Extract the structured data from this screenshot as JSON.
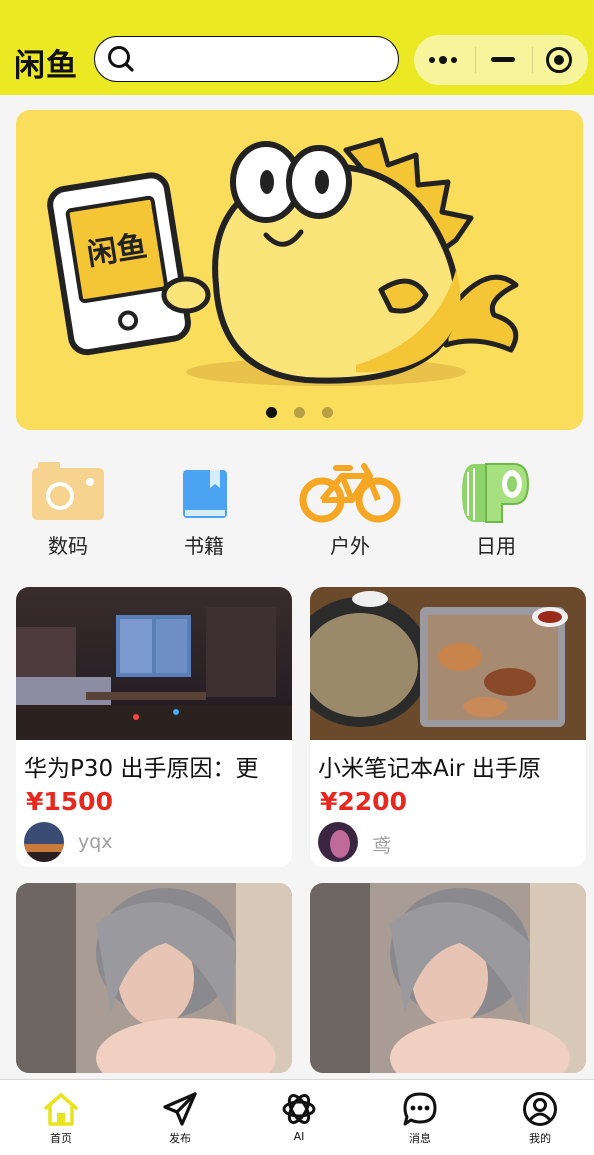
{
  "header": {
    "logo": "闲鱼",
    "search_placeholder": "",
    "accent_color": "#ebe824"
  },
  "banner": {
    "phone_text": "闲鱼",
    "slide_count": 3,
    "active_slide": 1
  },
  "categories": [
    {
      "label": "数码",
      "icon": "camera-icon",
      "color": "#f6d490"
    },
    {
      "label": "书籍",
      "icon": "book-icon",
      "color": "#4da3f3"
    },
    {
      "label": "户外",
      "icon": "bicycle-icon",
      "color": "#f5a623"
    },
    {
      "label": "日用",
      "icon": "tissue-roll-icon",
      "color": "#8fd36b"
    }
  ],
  "products": [
    {
      "title": "华为P30 出手原因：更",
      "price": "¥1500",
      "user": "yqx",
      "image": "room-photo"
    },
    {
      "title": "小米笔记本Air 出手原",
      "price": "¥2200",
      "user": "鸢",
      "image": "food-photo"
    },
    {
      "title": "",
      "price": "",
      "user": "",
      "image": "portrait-photo"
    },
    {
      "title": "",
      "price": "",
      "user": "",
      "image": "portrait-photo"
    }
  ],
  "tabbar": [
    {
      "label": "首页",
      "icon": "home-icon",
      "active": true
    },
    {
      "label": "发布",
      "icon": "send-icon",
      "active": false
    },
    {
      "label": "AI",
      "icon": "ai-icon",
      "active": false
    },
    {
      "label": "消息",
      "icon": "message-icon",
      "active": false
    },
    {
      "label": "我的",
      "icon": "user-icon",
      "active": false
    }
  ]
}
